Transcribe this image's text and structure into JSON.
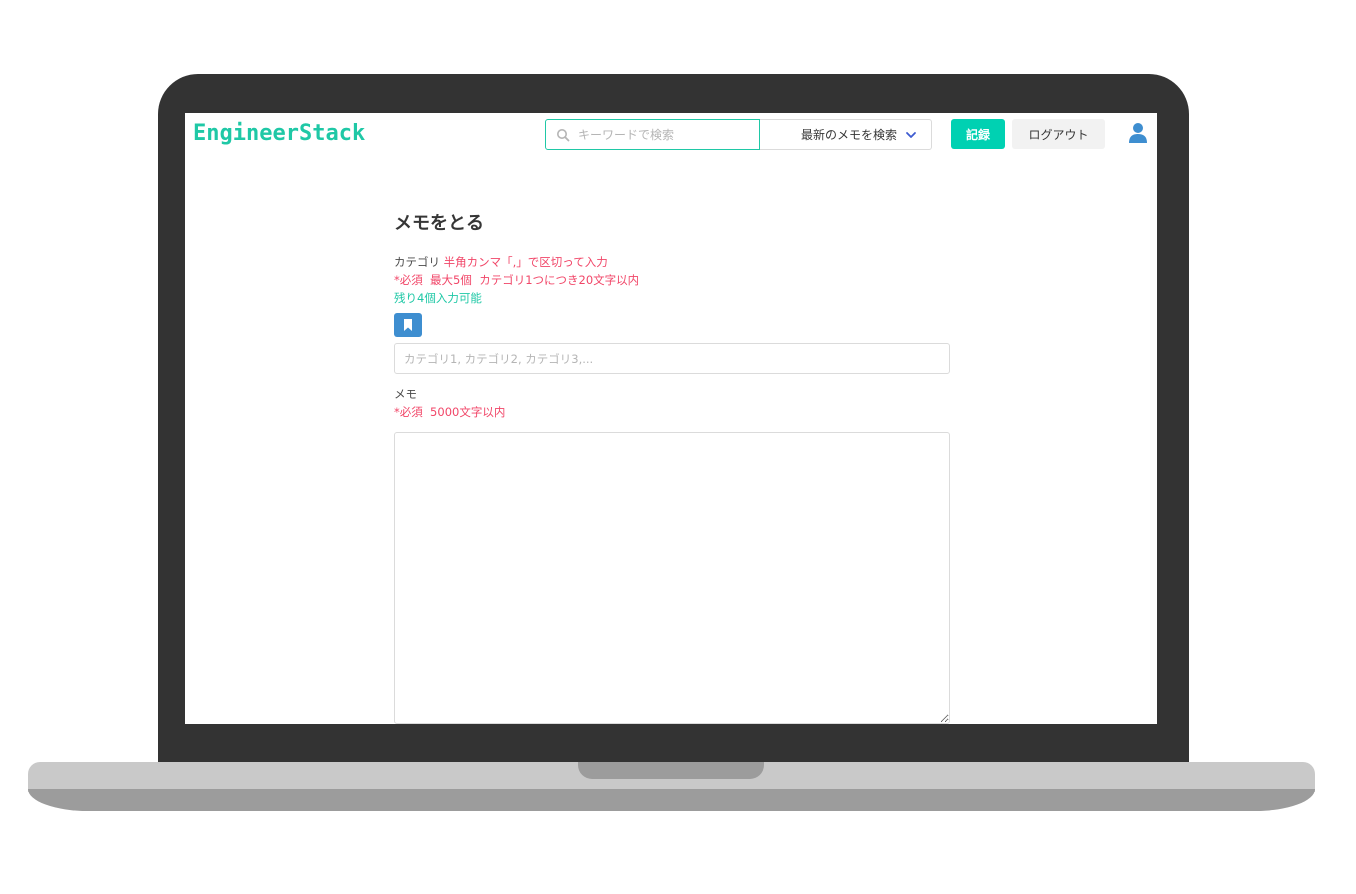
{
  "header": {
    "logo": "EngineerStack",
    "search_placeholder": "キーワードで検索",
    "sort_select_label": "最新のメモを検索",
    "record_button": "記録",
    "logout_button": "ログアウト"
  },
  "form": {
    "title": "メモをとる",
    "category": {
      "label": "カテゴリ",
      "hint": "半角カンマ「,」で区切って入力",
      "rule": "*必須  最大5個  カテゴリ1つにつき20文字以内",
      "remaining": "残り4個入力可能",
      "placeholder": "カテゴリ1, カテゴリ2, カテゴリ3,..."
    },
    "memo": {
      "label": "メモ",
      "rule": "*必須  5000文字以内"
    }
  },
  "colors": {
    "accent": "#1fc8a6",
    "primary_button": "#00d1b2",
    "required_text": "#f14668",
    "tag_button": "#3e8ed0",
    "laptop_frame": "#333333"
  }
}
